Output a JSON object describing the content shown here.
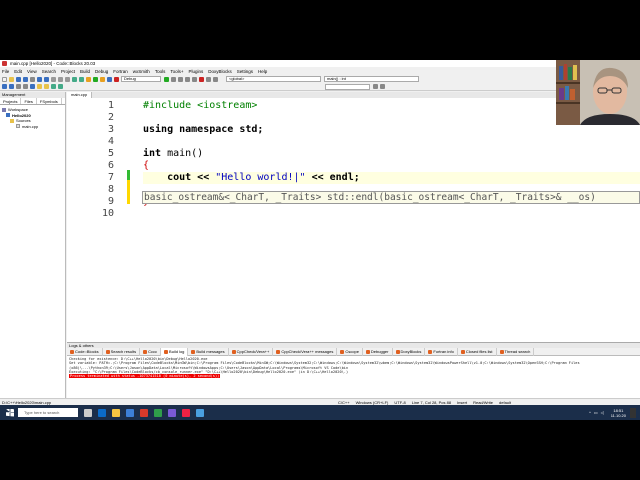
{
  "window": {
    "title": "main.cpp [Hello2020] - Code::Blocks 20.03",
    "controls": [
      "—",
      "☐",
      "✕"
    ]
  },
  "menu": [
    "File",
    "Edit",
    "View",
    "Search",
    "Project",
    "Build",
    "Debug",
    "Fortran",
    "wxSmith",
    "Tools",
    "Tools+",
    "Plugins",
    "DoxyBlocks",
    "Settings",
    "Help"
  ],
  "toolbar": {
    "build_target": "Debug",
    "scope": "<global>",
    "symbol": "main() : int"
  },
  "management": {
    "title": "Management",
    "tabs": [
      "Projects",
      "Files",
      "FSymbols"
    ],
    "tree": [
      {
        "label": "Workspace",
        "level": 0
      },
      {
        "label": "Hello2020",
        "level": 1
      },
      {
        "label": "Sources",
        "level": 2
      },
      {
        "label": "main.cpp",
        "level": 3
      }
    ]
  },
  "editor": {
    "tab": "main.cpp",
    "line_numbers": [
      "1",
      "2",
      "3",
      "4",
      "5",
      "6",
      "7",
      "8",
      "9",
      "10"
    ],
    "lines": {
      "l1": "#include <iostream>",
      "l3a": "using namespace",
      "l3b": " std;",
      "l5a": "int",
      "l5b": " main()",
      "l6": "{",
      "l7a": "    cout << ",
      "l7b": "\"Hello world!|\"",
      "l7c": " << endl;",
      "l9": "}"
    },
    "tooltip": "basic_ostream&<_CharT, _Traits> std::endl(basic_ostream<_CharT, _Traits>& __os)"
  },
  "logs": {
    "title": "Logs & others",
    "tabs": [
      "Code::Blocks",
      "Search results",
      "Cccc",
      "Build log",
      "Build messages",
      "CppCheck/Vera++",
      "CppCheck/Vera++ messages",
      "Cscope",
      "Debugger",
      "DoxyBlocks",
      "Fortran info",
      "Closed files list",
      "Thread search"
    ],
    "active_tab": "Build log",
    "lines": [
      "Checking for existence: D:\\C++\\Hello2020\\bin\\Debug\\Hello2020.exe",
      "Set variable: PATH=.;C:\\Program Files\\CodeBlocks\\MinGW\\bin;C:\\Program Files\\CodeBlocks\\MinGW;C:\\Windows\\System32;C:\\Windows;C:\\Windows\\System32\\wbem;C:\\Windows\\System32\\WindowsPowerShell\\v1.0;C:\\Windows\\System32\\OpenSSH;C:\\Program Files",
      "(x86)\\...\\Python39;C:\\Users\\Jason\\AppData\\Local\\Microsoft\\WindowsApps;C:\\Users\\Jason\\AppData\\Local\\Programs\\Microsoft VS Code\\bin",
      "Executing: \"C:\\Program Files\\CodeBlocks/cb_console_runner.exe\" \"D:\\C++\\Hello2020\\bin\\Debug\\Hello2020.exe\"  (in D:\\C++\\Hello2020\\.)"
    ],
    "error_line": "Process terminated with status -1073741510 (0 minute(s), 2 second(s))"
  },
  "status": {
    "path": "D:\\C++\\Hello2020\\main.cpp",
    "lang": "C/C++",
    "eol": "Windows (CR+LF)",
    "encoding": "UTF-8",
    "position": "Line 7, Col 28, Pos 88",
    "mode": "Insert",
    "access": "Read/Write",
    "profile": "default"
  },
  "taskbar": {
    "search": "Type here to search",
    "time": "18:51",
    "date": "11.10.20"
  }
}
